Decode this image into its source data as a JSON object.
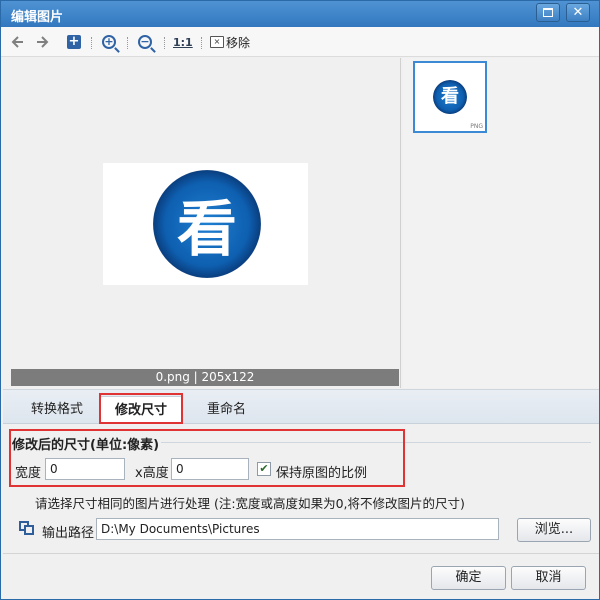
{
  "window": {
    "title": "编辑图片",
    "close_glyph": "✕"
  },
  "toolbar": {
    "back_icon": "arrow-left-icon",
    "forward_icon": "arrow-right-icon",
    "add_glyph": "+",
    "zoom_in_glyph": "+",
    "zoom_out_glyph": "−",
    "ratio_label": "1:1",
    "remove_glyph": "×",
    "remove_label": "移除"
  },
  "preview": {
    "icon_glyph": "看",
    "status": "0.png | 205x122"
  },
  "thumbnails": [
    {
      "glyph": "看",
      "ext": "PNG",
      "selected": true
    }
  ],
  "tabs": [
    {
      "label": "转换格式",
      "active": false
    },
    {
      "label": "修改尺寸",
      "active": true
    },
    {
      "label": "重命名",
      "active": false
    }
  ],
  "resize": {
    "section_title": "修改后的尺寸(单位:像素)",
    "width_label": "宽度",
    "width_value": "0",
    "height_label": "x高度",
    "height_value": "0",
    "keep_ratio_label": "保持原图的比例",
    "keep_ratio_checked": true,
    "check_glyph": "✔",
    "note": "请选择尺寸相同的图片进行处理 (注:宽度或高度如果为0,将不修改图片的尺寸)"
  },
  "output": {
    "label": "输出路径",
    "path": "D:\\My Documents\\Pictures",
    "browse_label": "浏览..."
  },
  "footer": {
    "ok_label": "确定",
    "cancel_label": "取消"
  },
  "colors": {
    "titlebar": "#3278be",
    "highlight": "#e03333",
    "accent": "#2f63a6"
  }
}
